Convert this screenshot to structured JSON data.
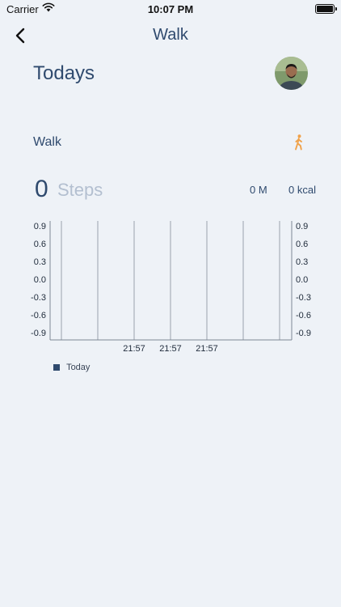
{
  "status_bar": {
    "carrier": "Carrier",
    "time": "10:07 PM"
  },
  "nav": {
    "title": "Walk"
  },
  "header": {
    "title": "Todays"
  },
  "activity": {
    "name": "Walk"
  },
  "stats": {
    "steps": "0",
    "steps_label": "Steps",
    "distance": "0 M",
    "calories": "0 kcal"
  },
  "colors": {
    "primary": "#2f4a6e",
    "accent": "#f0a24a",
    "background": "#eef2f7"
  },
  "chart_data": {
    "type": "bar",
    "x": [
      "21:57",
      "21:57",
      "21:57"
    ],
    "series": [
      {
        "name": "Today",
        "values": [
          0,
          0,
          0
        ]
      }
    ],
    "y_ticks": [
      "0.9",
      "0.6",
      "0.3",
      "0.0",
      "-0.3",
      "-0.6",
      "-0.9"
    ],
    "ylim": [
      -0.9,
      0.9
    ],
    "legend": "bottom-left",
    "grid": "vertical"
  }
}
